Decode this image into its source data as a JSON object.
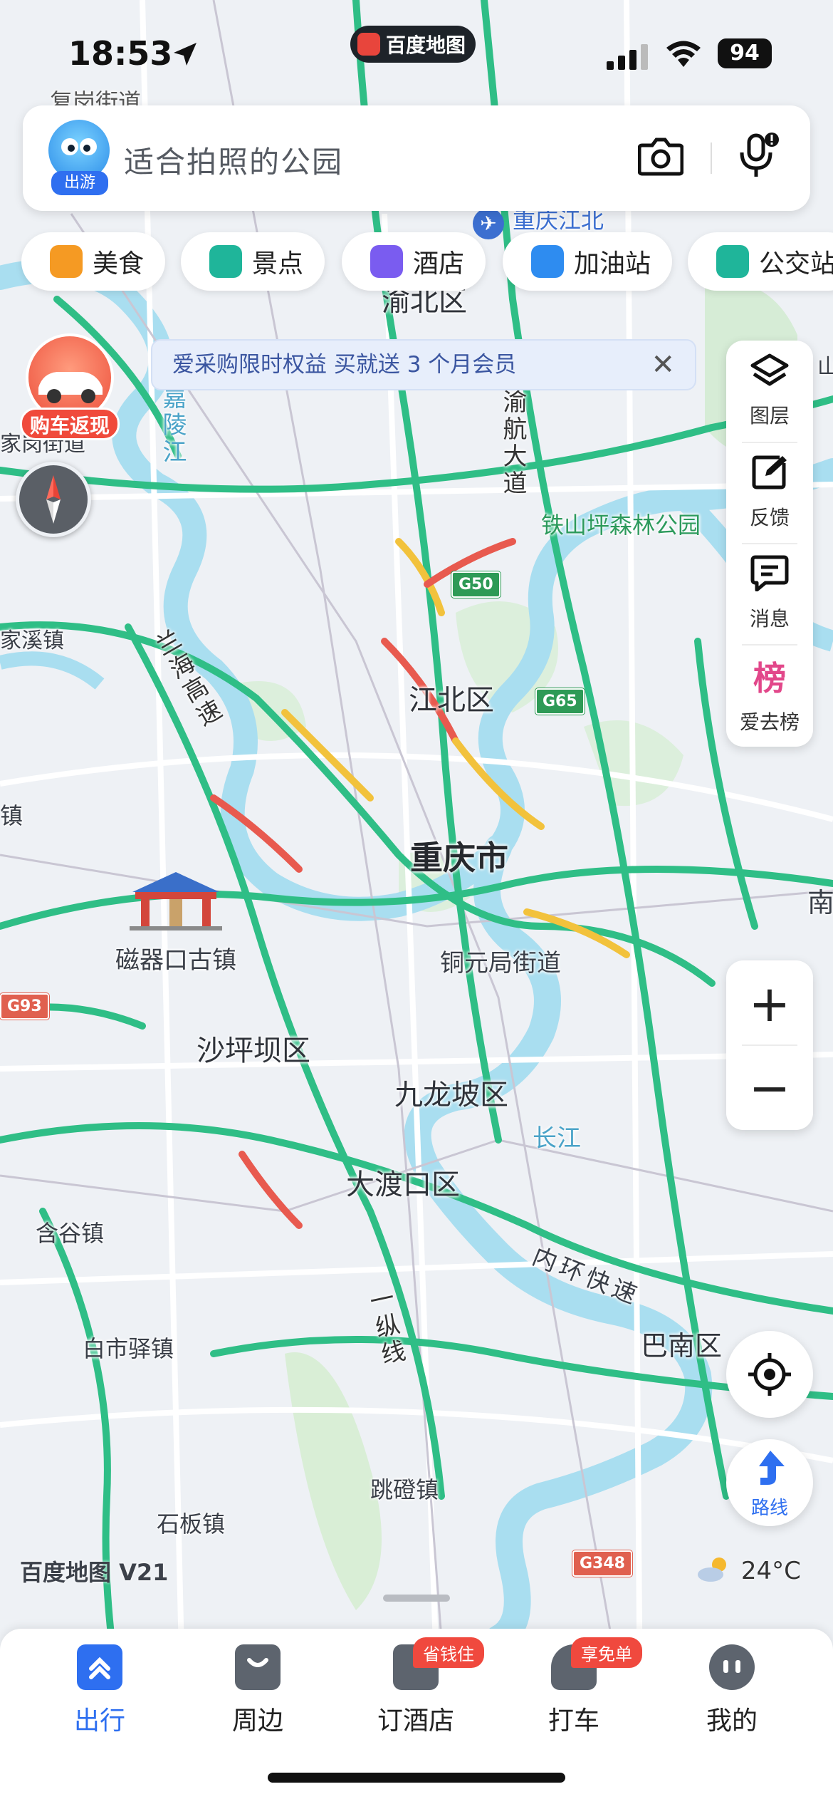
{
  "status_bar": {
    "time": "18:53",
    "app_name": "百度地图",
    "battery": "94"
  },
  "search": {
    "placeholder": "适合拍照的公园",
    "mascot_tag": "出游",
    "camera_icon": "camera-icon",
    "mic_icon": "mic-icon"
  },
  "chips": [
    {
      "label": "美食",
      "icon": "food-icon",
      "color": "#f59a23"
    },
    {
      "label": "景点",
      "icon": "scenic-icon",
      "color": "#1fb59a"
    },
    {
      "label": "酒店",
      "icon": "hotel-icon",
      "color": "#7a5cf0"
    },
    {
      "label": "加油站",
      "icon": "gas-station-icon",
      "color": "#2e8cf0"
    },
    {
      "label": "公交站",
      "icon": "bus-icon",
      "color": "#1fb59a"
    }
  ],
  "banner": {
    "text": "爱采购限时权益 买就送 3 个月会员"
  },
  "promo": {
    "label": "购车返现"
  },
  "side_panel": [
    {
      "label": "图层",
      "icon": "layers-icon"
    },
    {
      "label": "反馈",
      "icon": "feedback-icon"
    },
    {
      "label": "消息",
      "icon": "message-icon"
    },
    {
      "label": "爱去榜",
      "icon": "ranking-icon",
      "glyph": "榜"
    }
  ],
  "zoom": {
    "in": "+",
    "out": "−"
  },
  "route": {
    "label": "路线"
  },
  "watermark": "百度地图 V21",
  "weather": {
    "temp": "24°C"
  },
  "map_labels": {
    "city": "重庆市",
    "jiangbei_district": "江北区",
    "yubei_district": "渝北区",
    "shapingba_district": "沙坪坝区",
    "jiulongpo_district": "九龙坡区",
    "dadukou_district": "大渡口区",
    "banan_district": "巴南区",
    "ciqikou": "磁器口古镇",
    "tongyuanju": "铜元局街道",
    "tieshanping": "铁山坪森林公园",
    "jiangbei_airport": "重庆江北",
    "yuhang_avenue": "渝航大道",
    "lanhai_expressway": "兰海高速",
    "jialing_river": "嘉陵江",
    "yangtze": "长江",
    "inner_ring": "内环快速",
    "yizongxian": "一纵线",
    "hangu": "含谷镇",
    "baishiyi": "白市驿镇",
    "shiban": "石板镇",
    "tiaodeng": "跳磴镇",
    "jiaxi": "家溪镇",
    "fugang": "复岗街道",
    "jiagang": "家岗街道",
    "zhen_left": "镇",
    "nan_right": "南",
    "shan_right": "山"
  },
  "road_shields": {
    "g50": "G50",
    "g65": "G65",
    "g93": "G93",
    "g348": "G348"
  },
  "tabs": [
    {
      "label": "出行",
      "icon": "travel-icon",
      "active": true
    },
    {
      "label": "周边",
      "icon": "nearby-icon"
    },
    {
      "label": "订酒店",
      "icon": "hotel-booking-icon",
      "badge": "省钱住"
    },
    {
      "label": "打车",
      "icon": "taxi-icon",
      "badge": "享免单"
    },
    {
      "label": "我的",
      "icon": "profile-icon"
    }
  ]
}
